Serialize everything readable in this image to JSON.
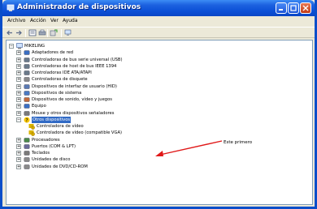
{
  "window": {
    "title": "Administrador de dispositivos"
  },
  "menu": [
    "Archivo",
    "Acción",
    "Ver",
    "Ayuda"
  ],
  "toolbar": {
    "icons": [
      "back-arrow-icon",
      "forward-arrow-icon",
      "properties-icon",
      "print-icon",
      "update-driver-icon",
      "scan-hardware-icon"
    ]
  },
  "tree": {
    "root": "MIKELING",
    "categories": [
      "Adaptadores de red",
      "Controladoras de bus serie universal (USB)",
      "Controladoras de host de bus IEEE 1394",
      "Controladoras IDE ATA/ATAPI",
      "Controladoras de disquete",
      "Dispositivos de interfaz de usuario (HID)",
      "Dispositivos de sistema",
      "Dispositivos de sonido, vídeo y juegos",
      "Equipo",
      "Mouse y otros dispositivos señaladores",
      "Otros dispositivos",
      "Procesadores",
      "Puertos (COM & LPT)",
      "Teclados",
      "Unidades de disco",
      "Unidades de DVD/CD-ROM"
    ],
    "selected": "Otros dispositivos",
    "expanded_children": [
      "Controladora de vídeo",
      "Controladora de vídeo (compatible VGA)"
    ],
    "expander_collapsed": "+",
    "expander_expanded": "−"
  },
  "annotation": {
    "text": "Este primero",
    "color": "#e01818"
  },
  "colors": {
    "title_blue": "#0b4fd6",
    "selection": "#316ac5",
    "warning_yellow": "#f5c400"
  }
}
